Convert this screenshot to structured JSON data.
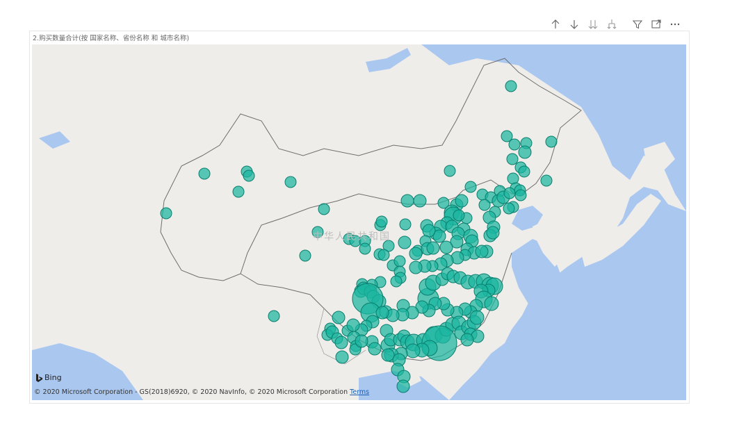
{
  "toolbar": {
    "buttons": [
      {
        "name": "drill-up-button",
        "icon": "arrow-up-icon"
      },
      {
        "name": "drill-down-button",
        "icon": "arrow-down-icon"
      },
      {
        "name": "next-level-button",
        "icon": "double-arrow-down-icon"
      },
      {
        "name": "expand-hierarchy-button",
        "icon": "fork-down-icon"
      },
      {
        "name": "filter-button",
        "icon": "filter-icon"
      },
      {
        "name": "focus-mode-button",
        "icon": "focus-icon"
      },
      {
        "name": "more-options-button",
        "icon": "ellipsis-icon"
      }
    ]
  },
  "visual": {
    "title": "2.购买数量合计(按 国家名称、省份名称 和 城市名称)",
    "country_label": "中华人民共和国",
    "bing_label": "Bing",
    "copyright": "© 2020 Microsoft Corporation - GS(2018)6920, © 2020 NavInfo, © 2020 Microsoft Corporation",
    "terms_label": "Terms"
  },
  "colors": {
    "water": "#aac7f0",
    "land": "#efedea",
    "border": "#6e6e6e",
    "bubble_fill": "#1ab5a0",
    "bubble_stroke": "#0a7d6d"
  }
}
